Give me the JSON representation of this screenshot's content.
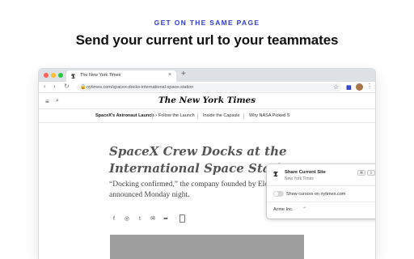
{
  "promo": {
    "eyebrow": "GET ON THE SAME PAGE",
    "headline": "Send your current url to your teammates"
  },
  "browser": {
    "tab": {
      "favicon": "𝕿",
      "title": "The New York Times",
      "close": "×"
    },
    "new_tab": "+",
    "nav": {
      "back": "‹",
      "forward": "›",
      "reload": "↻"
    },
    "address": {
      "lock": "🔒",
      "url": "nytimes.com/spacex-docks-international-space-station"
    },
    "bookmark_star": "☆",
    "extension_bars": "▮▮",
    "menu": "⋮"
  },
  "site": {
    "menu_icon": "≡",
    "search_icon": "⌕",
    "masthead": "The New York Times",
    "sections": [
      {
        "label": "SpaceX's Astronaut Launch ›",
        "bold": true
      },
      {
        "label": "Follow the Launch"
      },
      {
        "label": "Inside the Capsule"
      },
      {
        "label": "Why NASA Picked S"
      }
    ],
    "article": {
      "title": "SpaceX Crew Docks at the International Space Station",
      "dek": "“Docking confirmed,” the company founded by Elon Musk announced Monday night."
    },
    "share_icons": [
      "f",
      "◎",
      "t",
      "✉",
      "➦"
    ]
  },
  "popup": {
    "logo": "𝕿",
    "title": "Share Current Site",
    "subtitle": "New York Times",
    "shortcut_keys": [
      "⌘",
      "⇧",
      "S"
    ],
    "toggle_label": "Show cursors on nytimes.com",
    "toggle_on": false,
    "org": "Acme Inc.",
    "org_chevron": "⌃",
    "settings_icon": "⚙"
  },
  "colors": {
    "accent": "#2f3bd6",
    "traffic": [
      "#ff5f57",
      "#febc2e",
      "#28c840"
    ]
  }
}
